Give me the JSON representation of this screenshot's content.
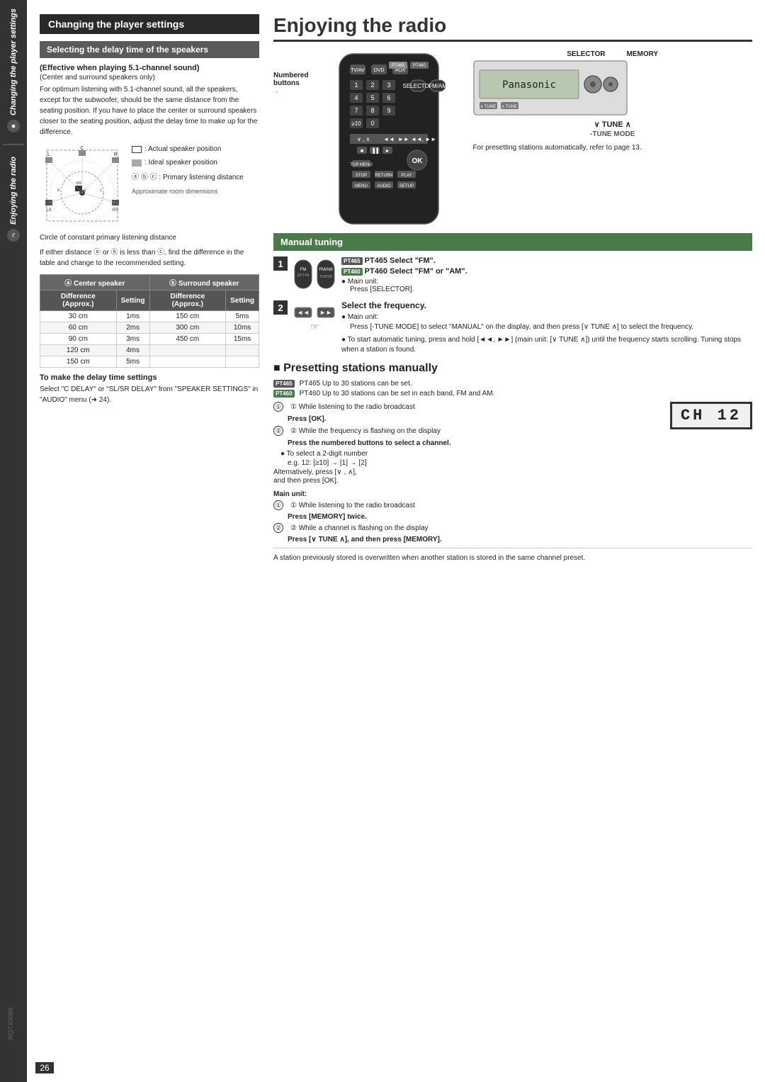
{
  "sidebar": {
    "tab1_label": "Changing the player settings",
    "tab2_label": "Enjoying the radio",
    "icon1": "disc-icon",
    "icon2": "music-icon"
  },
  "left_section": {
    "main_title": "Changing the player settings",
    "subsection_title": "Selecting the delay time of the speakers",
    "effective_label": "(Effective when playing 5.1-channel sound)",
    "center_only": "(Center and surround speakers only)",
    "body_text": "For optimum listening with 5.1-channel sound, all the speakers, except for the subwoofer, should be the same distance from the seating position. If you have to place the center or surround speakers closer to the seating position, adjust the delay time to make up for the difference.",
    "legend1": ": Actual speaker position",
    "legend2": ": Ideal speaker position",
    "legend3": "ⓐ ⓑ ⓒ : Primary listening distance",
    "diagram_note": "Approximate room dimensions",
    "circle_note": "Circle of constant primary listening distance",
    "distance_note": "If either distance ⓐ or ⓑ is less than ⓒ, find the difference in the table and change to the recommended setting.",
    "table": {
      "center_header": "ⓐ Center speaker",
      "surround_header": "ⓑ Surround speaker",
      "col1": "Difference (Approx.)",
      "col2": "Setting",
      "col3": "Difference (Approx.)",
      "col4": "Setting",
      "rows": [
        {
          "d1": "30 cm",
          "s1": "1ms",
          "d2": "150 cm",
          "s2": "5ms"
        },
        {
          "d1": "60 cm",
          "s1": "2ms",
          "d2": "300 cm",
          "s2": "10ms"
        },
        {
          "d1": "90 cm",
          "s1": "3ms",
          "d2": "450 cm",
          "s2": "15ms"
        },
        {
          "d1": "120 cm",
          "s1": "4ms",
          "d2": "",
          "s2": ""
        },
        {
          "d1": "150 cm",
          "s1": "5ms",
          "d2": "",
          "s2": ""
        }
      ]
    },
    "make_delay_title": "To make the delay time settings",
    "make_delay_body": "Select \"C DELAY\" or \"SL/SR DELAY\" from \"SPEAKER SETTINGS\" in \"AUDIO\" menu (➜ 24)."
  },
  "right_section": {
    "page_title": "Enjoying the radio",
    "numbered_buttons_label": "Numbered\nbuttons",
    "pt465_label": "PT465",
    "pt460_label": "PT460",
    "selector_label": "SELECTOR",
    "memory_label": "MEMORY",
    "tune_label": "∨ TUNE ∧",
    "tune_mode_label": "-TUNE MODE",
    "preset_note": "For presetting stations automatically, refer to page 13.",
    "manual_tuning_title": "Manual tuning",
    "step1_number": "1",
    "step1_pt465_badge": "PT465",
    "step1_pt460_badge": "PT460",
    "step1_pt465_instruction": "PT465 Select \"FM\".",
    "step1_pt460_instruction": "PT460 Select \"FM\" or \"AM\".",
    "step1_main_unit": "● Main unit:",
    "step1_main_detail": "Press [SELECTOR].",
    "step2_number": "2",
    "step2_instruction": "Select the frequency.",
    "step2_main_unit": "● Main unit:",
    "step2_detail1": "Press [-TUNE MODE] to select \"MANUAL\" on the display, and then press [∨ TUNE ∧] to select the frequency.",
    "step2_detail2": "● To start automatic tuning, press and hold [◄◄, ►►] (main unit: [∨ TUNE ∧]) until the frequency starts scrolling. Tuning stops when a station is found.",
    "presetting_title": "Presetting stations manually",
    "pt465_stations": "PT465 Up to 30 stations can be set.",
    "pt460_stations": "PT460 Up to 30 stations can be set in each band, FM and AM.",
    "step_a1": "① While listening to the radio broadcast",
    "step_a1b": "Press [OK].",
    "step_a2": "② While the frequency is flashing on the display",
    "step_a2b": "Press the numbered buttons to select a channel.",
    "select_2digit_bullet": "● To select a 2-digit number",
    "select_2digit_example": "e.g. 12: [≥10] → [1] → [2]",
    "alternatively_text": "Alternatively, press [∨ , ∧],",
    "and_then_text": "and then press [OK].",
    "channel_display": "CH 12",
    "main_unit_label": "Main unit:",
    "main_step1": "① While listening to the radio broadcast",
    "main_step1b": "Press [MEMORY] twice.",
    "main_step2": "② While a channel is flashing on the display",
    "main_step2b": "Press [∨ TUNE ∧], and then press [MEMORY].",
    "final_note": "A station previously stored is overwritten when another station is stored in the same channel preset.",
    "page_number": "26",
    "rqtx_code": "RQTX0068"
  }
}
